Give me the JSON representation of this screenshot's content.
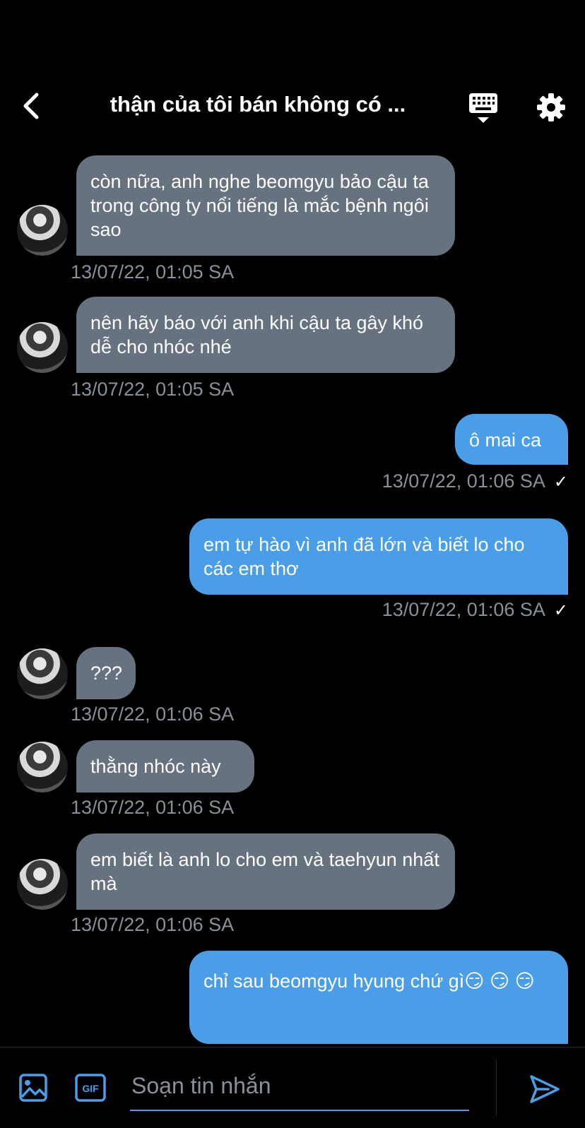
{
  "header": {
    "title": "thận của tôi bán không có ...",
    "back_icon": "chevron-left-icon",
    "keyboard_icon": "keyboard-icon",
    "settings_icon": "gear-icon"
  },
  "messages": [
    {
      "side": "in",
      "text": "còn nữa, anh nghe beomgyu bảo cậu ta trong công ty nổi tiếng là mắc bệnh ngôi sao",
      "time": "13/07/22, 01:05 SA"
    },
    {
      "side": "in",
      "text": "nên hãy báo với anh khi cậu ta gây khó dễ cho nhóc nhé",
      "time": "13/07/22, 01:05 SA"
    },
    {
      "side": "out",
      "text": "ô mai ca",
      "time": "13/07/22, 01:06 SA"
    },
    {
      "side": "out",
      "text": "em tự hào vì anh đã lớn và biết lo cho các em thơ",
      "time": "13/07/22, 01:06 SA"
    },
    {
      "side": "in",
      "text": "???",
      "time": "13/07/22, 01:06 SA"
    },
    {
      "side": "in",
      "text": "thằng nhóc này",
      "time": "13/07/22, 01:06 SA"
    },
    {
      "side": "in",
      "text": "em biết là anh lo cho em và taehyun nhất mà",
      "time": "13/07/22, 01:06 SA"
    },
    {
      "side": "out",
      "text": "chỉ sau beomgyu hyung chứ gì😏 😏 😏",
      "time": ""
    }
  ],
  "read_check": "✓",
  "composer": {
    "placeholder": "Soạn tin nhắn",
    "gif_label": "GIF",
    "image_icon": "image-icon",
    "send_icon": "send-icon"
  },
  "colors": {
    "incoming": "#66727f",
    "outgoing": "#4a9ee8",
    "timestamp": "#8a9099",
    "accent": "#4a9ee8"
  }
}
